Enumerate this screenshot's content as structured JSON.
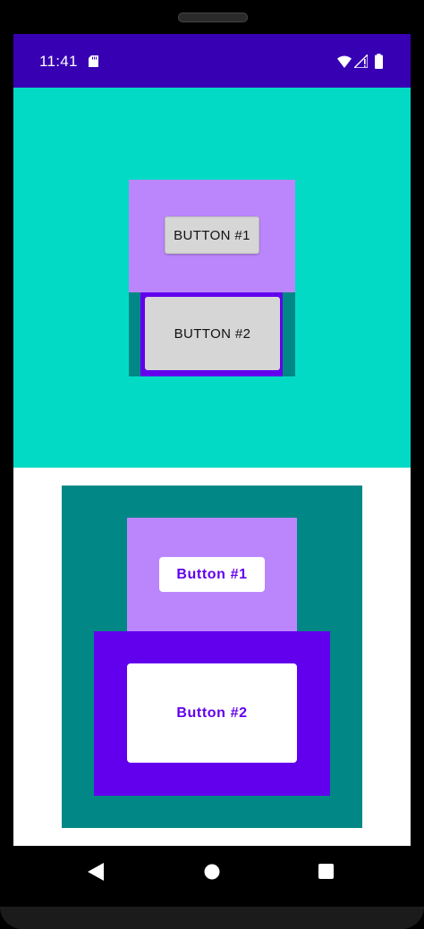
{
  "status_bar": {
    "time": "11:41",
    "background": "#3700b3",
    "icons": [
      "sd-card-icon",
      "wifi-icon",
      "signal-icon",
      "battery-icon"
    ]
  },
  "top_section": {
    "background": "#03dac5",
    "button_1_label": "BUTTON #1",
    "button_2_label": "BUTTON #2"
  },
  "bottom_section": {
    "background": "#ffffff",
    "button_1_label": "Button #1",
    "button_2_label": "Button #2"
  },
  "colors": {
    "teal": "#018786",
    "purple_light": "#bb86fc",
    "violet": "#6200ee",
    "grey_button": "#d6d6d6"
  },
  "nav_bar": {
    "icons": [
      "back-icon",
      "home-icon",
      "recents-icon"
    ]
  }
}
